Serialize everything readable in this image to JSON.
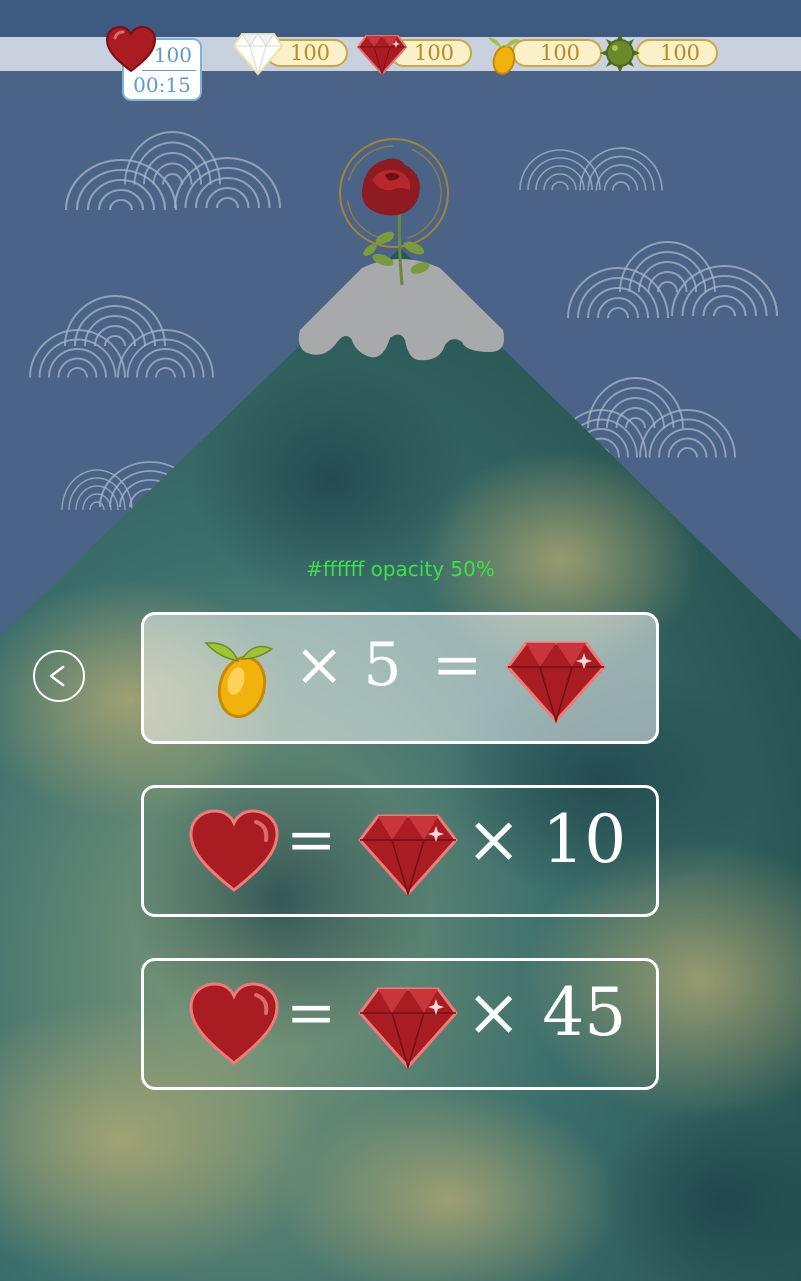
{
  "status_bar": {
    "lives": {
      "value": "100",
      "timer": "00:15"
    },
    "diamonds": "100",
    "rubies": "100",
    "seeds": "100",
    "spikes": "100"
  },
  "annotation": "#ffffff opacity 50%",
  "offers": [
    {
      "left": "× 5",
      "eq": "=",
      "right": ""
    },
    {
      "left": "",
      "eq": "=",
      "right": "× 10"
    },
    {
      "left": "",
      "eq": "=",
      "right": "× 45"
    }
  ],
  "colors": {
    "sky": "#4a6387",
    "mountain": "#2f6562",
    "accent_gold": "#c9a84a",
    "ruby": "#b8262e",
    "note": "#3ee04a"
  },
  "icons": [
    "heart-icon",
    "diamond-icon",
    "ruby-icon",
    "seed-icon",
    "spike-ball-icon",
    "rose-icon",
    "back-arrow-icon"
  ]
}
